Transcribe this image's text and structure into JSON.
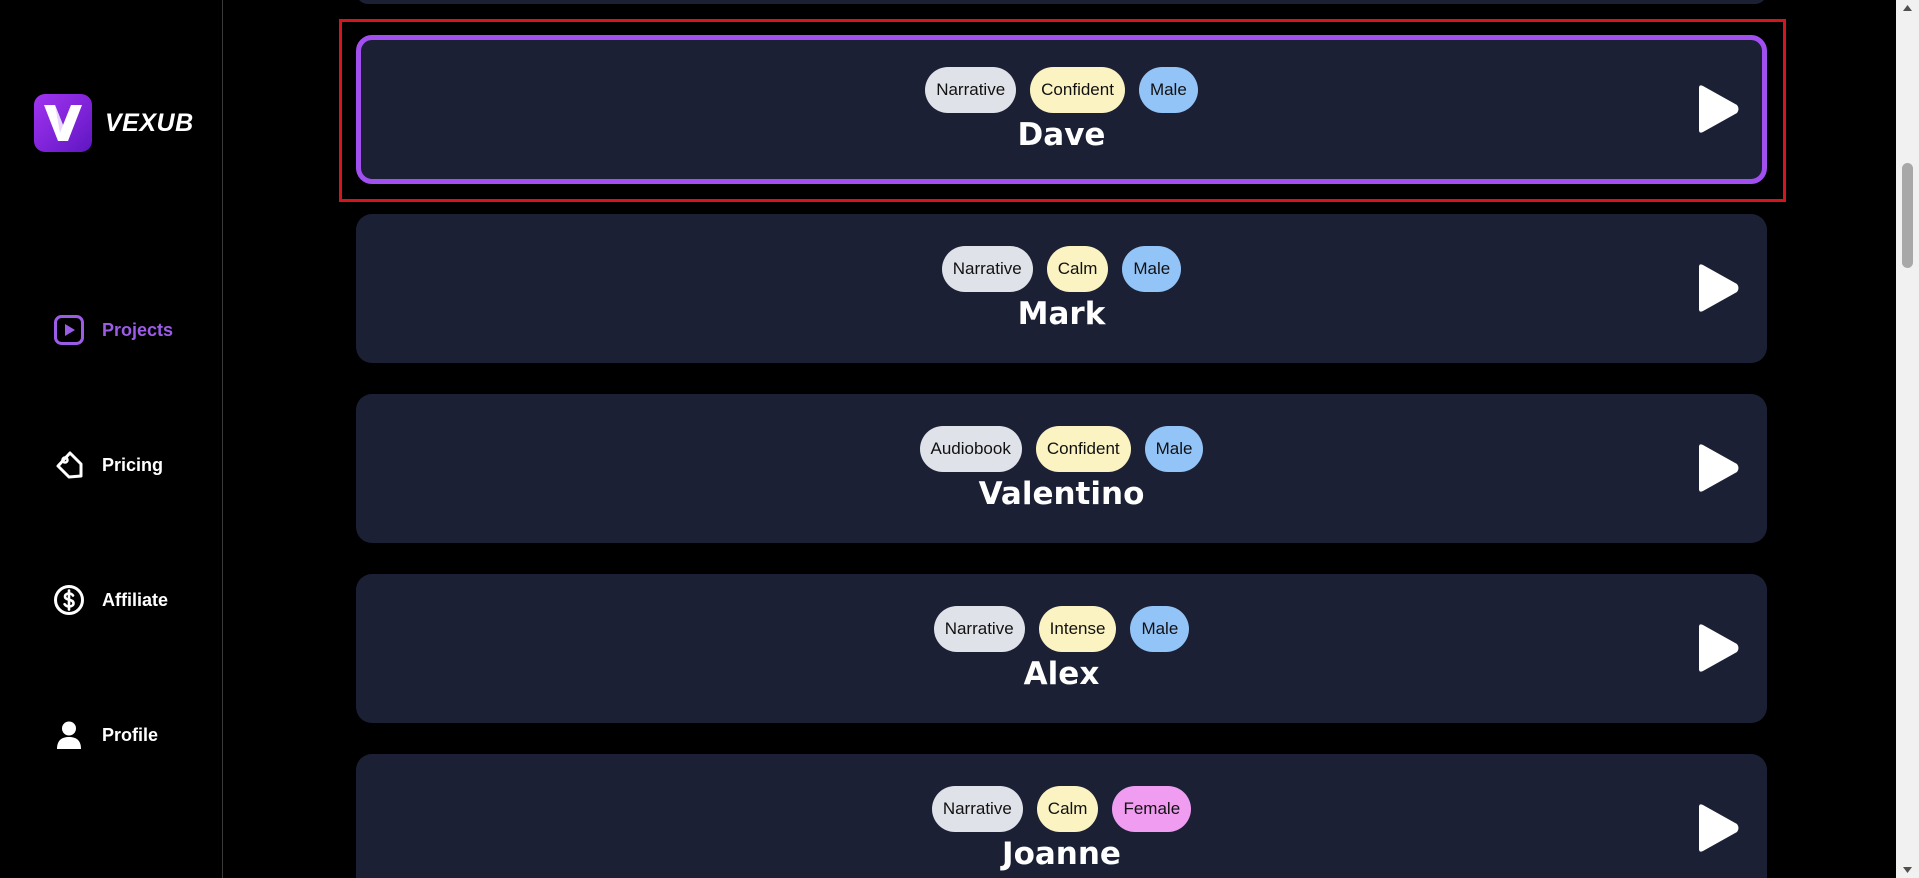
{
  "brand": {
    "name": "VEXUB",
    "accent": "#a24ff0"
  },
  "nav": [
    {
      "label": "Projects",
      "icon": "play-square-icon",
      "active": true
    },
    {
      "label": "Pricing",
      "icon": "price-tag-icon",
      "active": false
    },
    {
      "label": "Affiliate",
      "icon": "dollar-circle-icon",
      "active": false
    },
    {
      "label": "Profile",
      "icon": "user-icon",
      "active": false
    }
  ],
  "voices": [
    {
      "name": "Dave",
      "tags": [
        "Narrative",
        "Confident",
        "Male"
      ],
      "selected": true
    },
    {
      "name": "Mark",
      "tags": [
        "Narrative",
        "Calm",
        "Male"
      ],
      "selected": false
    },
    {
      "name": "Valentino",
      "tags": [
        "Audiobook",
        "Confident",
        "Male"
      ],
      "selected": false
    },
    {
      "name": "Alex",
      "tags": [
        "Narrative",
        "Intense",
        "Male"
      ],
      "selected": false
    },
    {
      "name": "Joanne",
      "tags": [
        "Narrative",
        "Calm",
        "Female"
      ],
      "selected": false
    }
  ],
  "colors": {
    "card_bg": "#1b2035",
    "selected_border": "#a24ff0",
    "highlight": "#d3161d",
    "tag_style": "#dfe2e8",
    "tag_mood": "#fbf3c1",
    "tag_male": "#93c4f7",
    "tag_female": "#f09df1"
  }
}
